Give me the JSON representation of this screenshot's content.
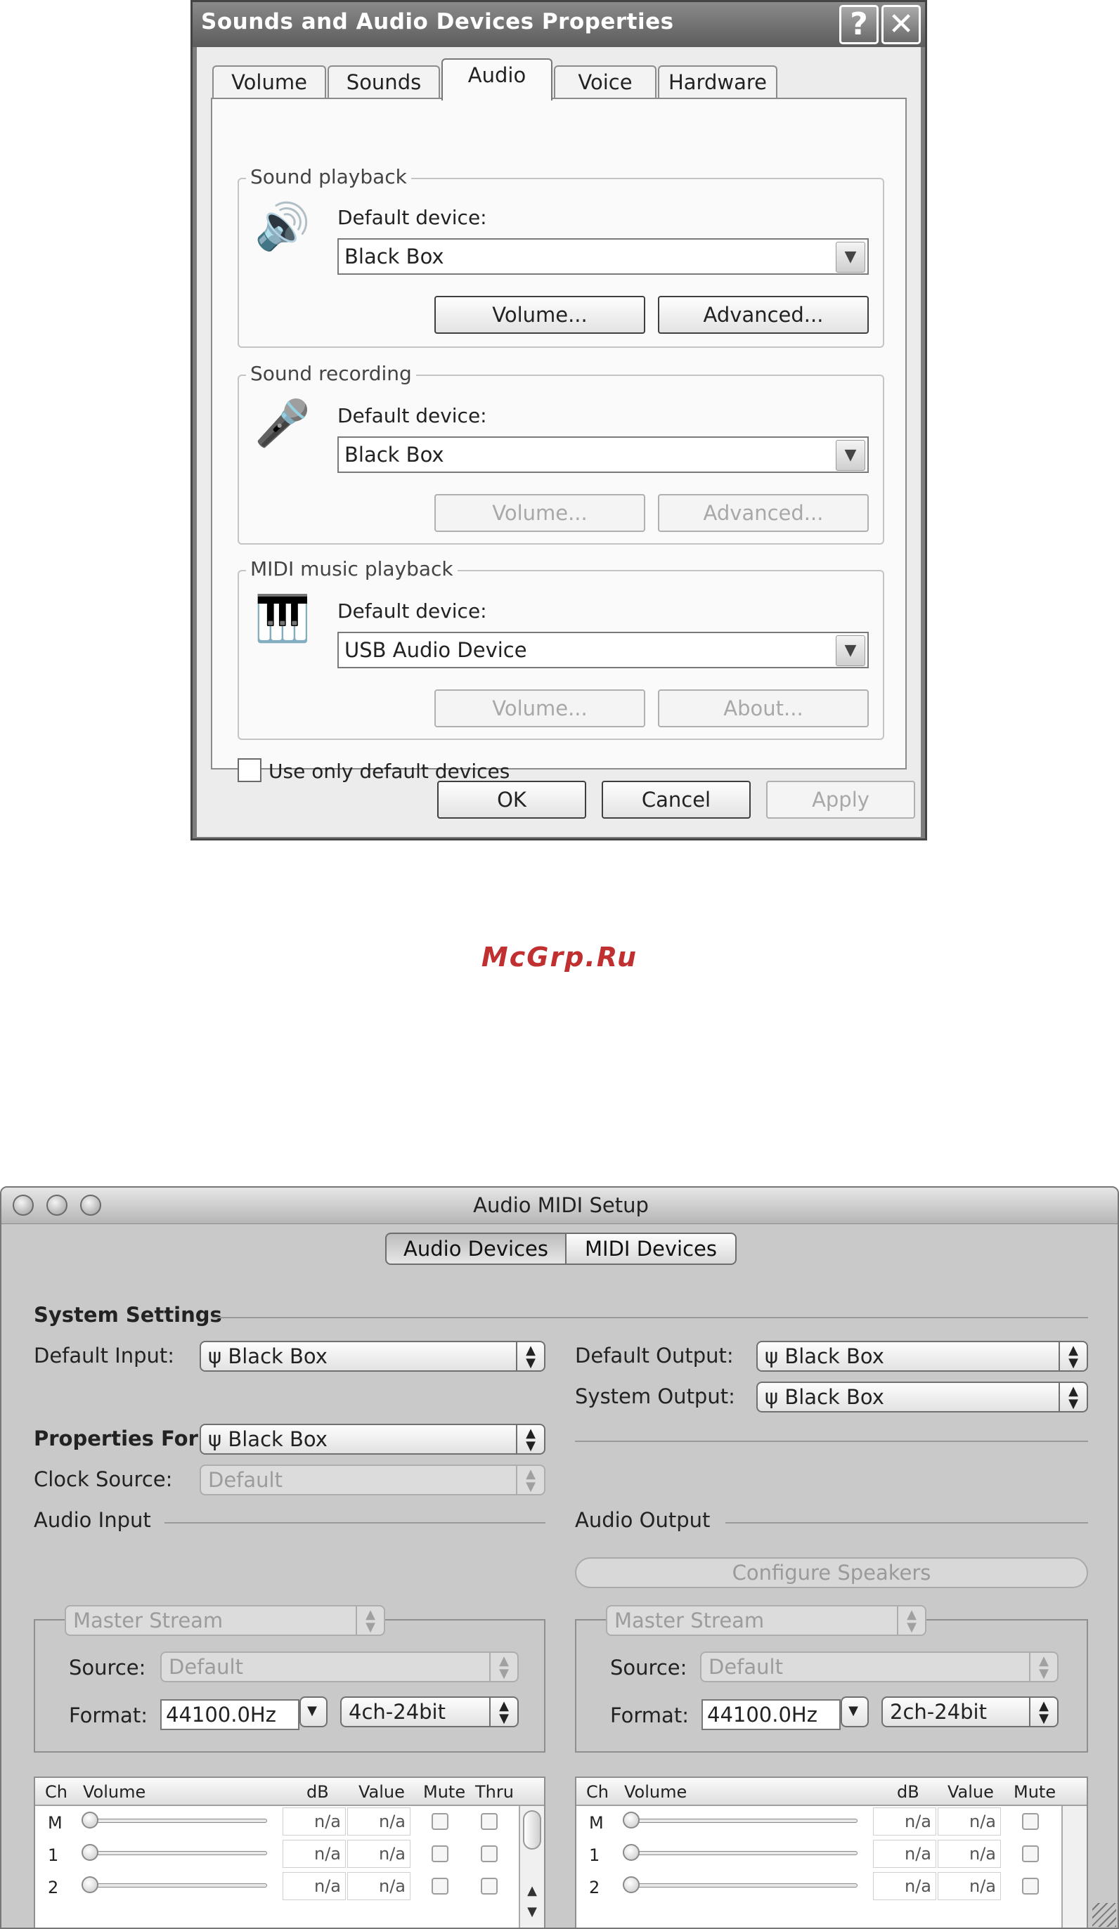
{
  "xp_dialog": {
    "title": "Sounds and Audio Devices Properties",
    "help_glyph": "?",
    "close_glyph": "✕",
    "tabs": [
      "Volume",
      "Sounds",
      "Audio",
      "Voice",
      "Hardware"
    ],
    "selected_tab": "Audio",
    "playback": {
      "group_label": "Sound playback",
      "default_label": "Default device:",
      "device": "Black Box",
      "btn1": "Volume...",
      "btn2": "Advanced...",
      "icon": "speaker-icon"
    },
    "recording": {
      "group_label": "Sound recording",
      "default_label": "Default device:",
      "device": "Black Box",
      "btn1": "Volume...",
      "btn2": "Advanced...",
      "icon": "microphone-icon"
    },
    "midi": {
      "group_label": "MIDI music playback",
      "default_label": "Default device:",
      "device": "USB Audio Device",
      "btn1": "Volume...",
      "btn2": "About...",
      "icon": "midi-keyboard-icon"
    },
    "use_default_label": "Use only default devices",
    "ok": "OK",
    "cancel": "Cancel",
    "apply": "Apply"
  },
  "watermark": "McGrp.Ru",
  "mac_window": {
    "title": "Audio MIDI Setup",
    "segments": [
      "Audio Devices",
      "MIDI Devices"
    ],
    "selected_segment": "Audio Devices",
    "system_settings": "System Settings",
    "default_input_label": "Default Input:",
    "default_input": "Black Box",
    "default_output_label": "Default Output:",
    "default_output": "Black Box",
    "system_output_label": "System Output:",
    "system_output": "Black Box",
    "properties_for_label": "Properties For:",
    "properties_for": "Black Box",
    "clock_source_label": "Clock Source:",
    "clock_source": "Default",
    "audio_input": "Audio Input",
    "audio_output": "Audio Output",
    "configure_speakers": "Configure Speakers",
    "input": {
      "stream": "Master Stream",
      "source_label": "Source:",
      "source": "Default",
      "format_label": "Format:",
      "rate": "44100.0Hz",
      "channels": "4ch-24bit",
      "columns": [
        "Ch",
        "Volume",
        "dB",
        "Value",
        "Mute",
        "Thru"
      ],
      "rows": [
        {
          "ch": "M",
          "db": "n/a",
          "value": "n/a"
        },
        {
          "ch": "1",
          "db": "n/a",
          "value": "n/a"
        },
        {
          "ch": "2",
          "db": "n/a",
          "value": "n/a"
        }
      ]
    },
    "output": {
      "stream": "Master Stream",
      "source_label": "Source:",
      "source": "Default",
      "format_label": "Format:",
      "rate": "44100.0Hz",
      "channels": "2ch-24bit",
      "columns": [
        "Ch",
        "Volume",
        "dB",
        "Value",
        "Mute"
      ],
      "rows": [
        {
          "ch": "M",
          "db": "n/a",
          "value": "n/a"
        },
        {
          "ch": "1",
          "db": "n/a",
          "value": "n/a"
        },
        {
          "ch": "2",
          "db": "n/a",
          "value": "n/a"
        }
      ]
    },
    "usb_icon": "usb-icon"
  }
}
